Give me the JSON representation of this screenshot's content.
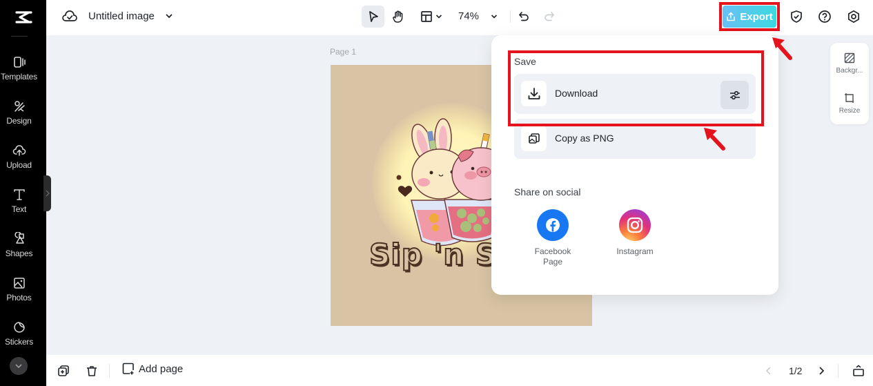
{
  "sidebar": {
    "logo": "capcut-logo",
    "items": [
      {
        "label": "Templates",
        "icon": "templates-icon"
      },
      {
        "label": "Design",
        "icon": "design-icon"
      },
      {
        "label": "Upload",
        "icon": "upload-icon"
      },
      {
        "label": "Text",
        "icon": "text-icon"
      },
      {
        "label": "Shapes",
        "icon": "shapes-icon"
      },
      {
        "label": "Photos",
        "icon": "photos-icon"
      },
      {
        "label": "Stickers",
        "icon": "stickers-icon"
      }
    ],
    "more": "chevron-down-icon"
  },
  "topbar": {
    "doc_title": "Untitled image",
    "zoom": "74%",
    "export_label": "Export",
    "colors": {
      "export_start": "#69c0f4",
      "export_end": "#3bd9e0"
    }
  },
  "canvas": {
    "page_label": "Page 1",
    "artwork_text": "Sip 'n Sa",
    "background": "#d8c4a4"
  },
  "side_panel": {
    "items": [
      {
        "label": "Backgr...",
        "icon": "background-icon"
      },
      {
        "label": "Resize",
        "icon": "resize-icon"
      }
    ]
  },
  "export_popup": {
    "save_heading": "Save",
    "options": [
      {
        "label": "Download",
        "icon": "download-icon"
      },
      {
        "label": "Copy as PNG",
        "icon": "copy-image-icon"
      }
    ],
    "share_heading": "Share on social",
    "social": [
      {
        "label": "Facebook Page",
        "icon": "facebook-icon",
        "color": "#1877f2"
      },
      {
        "label": "Instagram",
        "icon": "instagram-icon"
      }
    ]
  },
  "bottombar": {
    "add_page_label": "Add page",
    "page_count": "1/2"
  },
  "annotations": {
    "highlight_color": "#e5131e"
  }
}
